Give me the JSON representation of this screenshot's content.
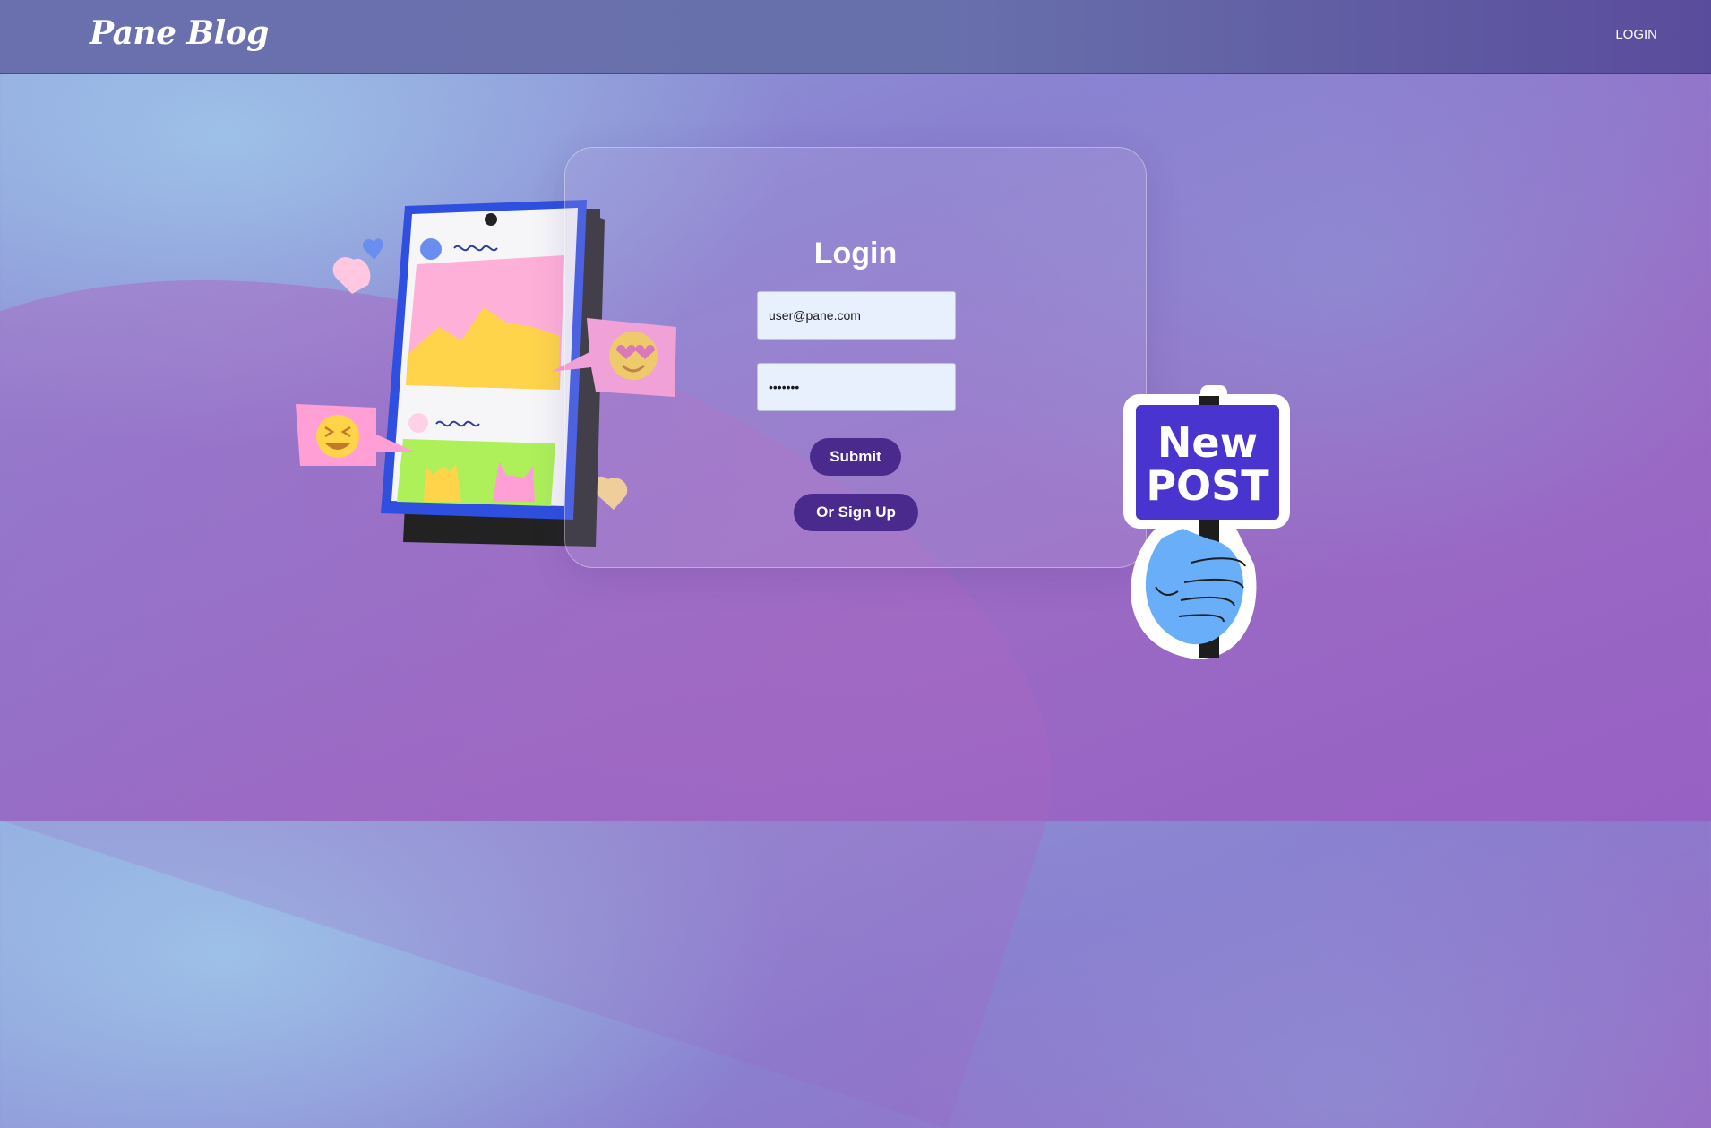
{
  "app": {
    "brand": "Pane Blog"
  },
  "nav": {
    "login_label": "LOGIN"
  },
  "login_form": {
    "title": "Login",
    "email_value": "user@pane.com",
    "password_value": "ppppppp",
    "submit_label": "Submit",
    "signup_label": "Or Sign Up"
  },
  "illustrations": {
    "sign_text_line1": "New",
    "sign_text_line2": "POST"
  },
  "colors": {
    "primary_button": "#4a2a8c",
    "navbar": "#6a70ad",
    "field_background": "#e8f0fe"
  }
}
